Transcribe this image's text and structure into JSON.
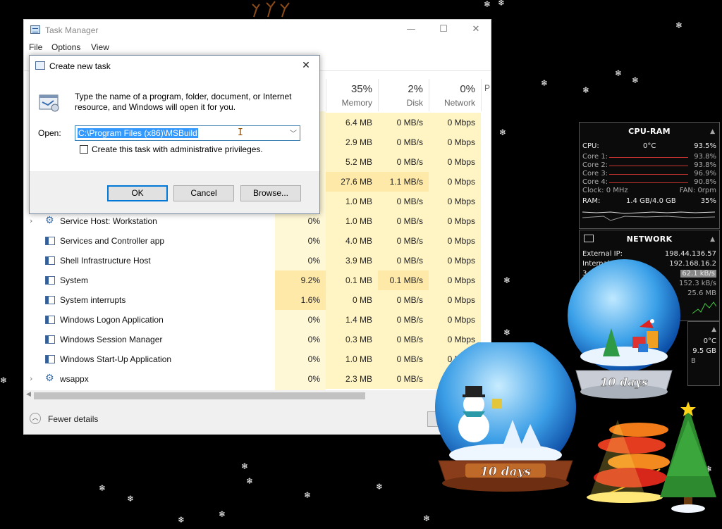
{
  "task_manager": {
    "title": "Task Manager",
    "menu": [
      "File",
      "Options",
      "View"
    ],
    "window_buttons": {
      "minimize": "—",
      "maximize": "☐",
      "close": "✕"
    },
    "columns": [
      {
        "pct": "35%",
        "label": "Memory"
      },
      {
        "pct": "2%",
        "label": "Disk"
      },
      {
        "pct": "0%",
        "label": "Network"
      },
      {
        "pct": "",
        "label": "P"
      }
    ],
    "partial_rows": [
      {
        "memory": "6.4 MB",
        "disk": "0 MB/s",
        "network": "0 Mbps"
      },
      {
        "memory": "2.9 MB",
        "disk": "0 MB/s",
        "network": "0 Mbps"
      },
      {
        "memory": "5.2 MB",
        "disk": "0 MB/s",
        "network": "0 Mbps"
      },
      {
        "memory": "27.6 MB",
        "disk": "1.1 MB/s",
        "network": "0 Mbps"
      },
      {
        "memory": "1.0 MB",
        "disk": "0 MB/s",
        "network": "0 Mbps"
      }
    ],
    "rows": [
      {
        "name": "Service Host: Workstation",
        "expand": "›",
        "cpu": "0%",
        "memory": "1.0 MB",
        "disk": "0 MB/s",
        "network": "0 Mbps"
      },
      {
        "name": "Services and Controller app",
        "expand": "",
        "cpu": "0%",
        "memory": "4.0 MB",
        "disk": "0 MB/s",
        "network": "0 Mbps"
      },
      {
        "name": "Shell Infrastructure Host",
        "expand": "",
        "cpu": "0%",
        "memory": "3.9 MB",
        "disk": "0 MB/s",
        "network": "0 Mbps"
      },
      {
        "name": "System",
        "expand": "",
        "cpu": "9.2%",
        "memory": "0.1 MB",
        "disk": "0.1 MB/s",
        "network": "0 Mbps"
      },
      {
        "name": "System interrupts",
        "expand": "",
        "cpu": "1.6%",
        "memory": "0 MB",
        "disk": "0 MB/s",
        "network": "0 Mbps"
      },
      {
        "name": "Windows Logon Application",
        "expand": "",
        "cpu": "0%",
        "memory": "1.4 MB",
        "disk": "0 MB/s",
        "network": "0 Mbps"
      },
      {
        "name": "Windows Session Manager",
        "expand": "",
        "cpu": "0%",
        "memory": "0.3 MB",
        "disk": "0 MB/s",
        "network": "0 Mbps"
      },
      {
        "name": "Windows Start-Up Application",
        "expand": "",
        "cpu": "0%",
        "memory": "1.0 MB",
        "disk": "0 MB/s",
        "network": "0 Mbps"
      },
      {
        "name": "wsappx",
        "expand": "›",
        "cpu": "0%",
        "memory": "2.3 MB",
        "disk": "0 MB/s",
        "network": "0 Mbps"
      }
    ],
    "fewer_details": "Fewer details"
  },
  "dialog": {
    "title": "Create new task",
    "close": "✕",
    "message": "Type the name of a program, folder, document, or Internet resource, and Windows will open it for you.",
    "open_label": "Open:",
    "open_value": "C:\\Program Files (x86)\\MSBuild",
    "admin_checkbox": "Create this task with administrative privileges.",
    "ok": "OK",
    "cancel": "Cancel",
    "browse": "Browse..."
  },
  "cpu_ram": {
    "title": "CPU-RAM",
    "cpu_label": "CPU:",
    "cpu_temp": "0°C",
    "cpu_value": "93.5%",
    "cores": [
      {
        "label": "Core 1:",
        "value": "93.8%"
      },
      {
        "label": "Core 2:",
        "value": "93.8%"
      },
      {
        "label": "Core 3:",
        "value": "96.9%"
      },
      {
        "label": "Core 4:",
        "value": "90.8%"
      }
    ],
    "clock": "Clock: 0 MHz",
    "fan": "FAN: 0rpm",
    "ram_label": "RAM:",
    "ram_value": "1.4 GB/4.0 GB",
    "ram_pct": "35%"
  },
  "network": {
    "title": "NETWORK",
    "external_label": "External IP:",
    "external_ip": "198.44.136.57",
    "internal_label": "Internal",
    "internal_ip": "192.168.16.2",
    "line3_label": "3",
    "speed": "62.1 kB/s",
    "up": "152.3 kB/s",
    "down": "25.6 MB"
  },
  "third_gadget": {
    "temp": "0°C",
    "size": "9.5 GB",
    "unit": "B"
  },
  "globes": [
    {
      "label": "10 days"
    },
    {
      "label": "10 days"
    }
  ],
  "colors": {
    "selection": "#3399ff",
    "heat_light": "#fff4c4",
    "heat_dark": "#ffe9a8",
    "default_button": "#0078d7"
  }
}
